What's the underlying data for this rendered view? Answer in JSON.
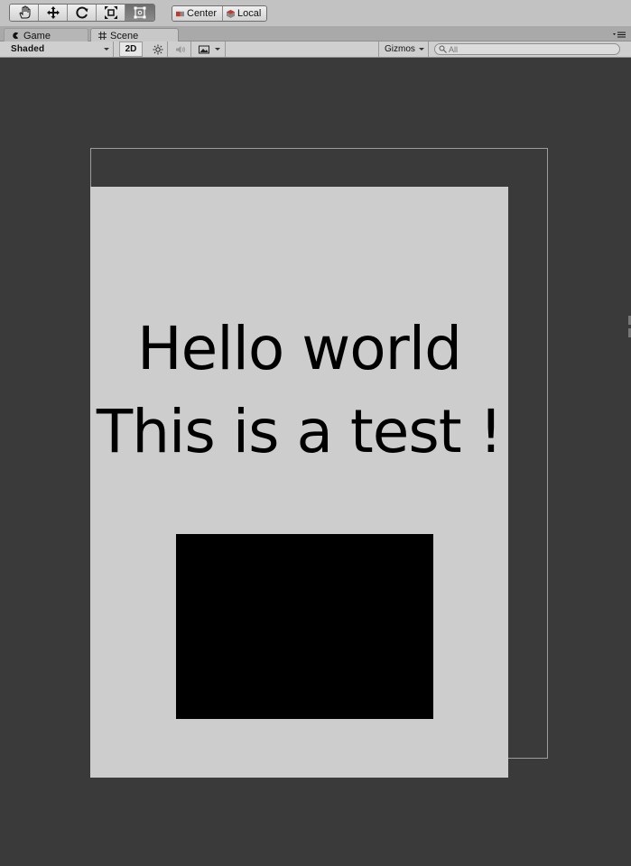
{
  "toolbar": {
    "tools": [
      {
        "name": "hand-tool",
        "icon": "hand-icon"
      },
      {
        "name": "move-tool",
        "icon": "move-arrows-icon"
      },
      {
        "name": "rotate-tool",
        "icon": "rotate-icon"
      },
      {
        "name": "scale-tool",
        "icon": "scale-icon"
      },
      {
        "name": "rect-tool",
        "icon": "rect-transform-icon",
        "active": true
      }
    ],
    "pivot_label": "Center",
    "rotation_label": "Local"
  },
  "tabs": {
    "game_label": "Game",
    "scene_label": "Scene"
  },
  "scene_controls": {
    "draw_mode": "Shaded",
    "mode_2d": "2D",
    "gizmos_label": "Gizmos",
    "search_placeholder": "All"
  },
  "scene": {
    "line1": "Hello world",
    "line2": "This is a test !"
  },
  "colors": {
    "viewport_bg": "#3a3a3a",
    "canvas_bg": "#cdcdcd",
    "panel": "#000000",
    "toolbar_bg": "#c2c2c2"
  }
}
